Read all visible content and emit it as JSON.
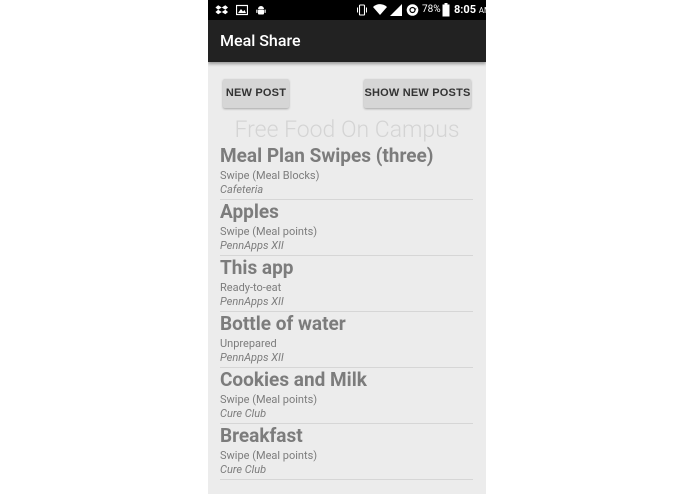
{
  "status_bar": {
    "battery": "78%",
    "time": "8:05",
    "ampm": "AM",
    "icons": [
      "dropbox-icon",
      "image-icon",
      "android-icon",
      "vibrate-icon",
      "wifi-icon",
      "signal-icon",
      "sync-icon",
      "battery-icon"
    ]
  },
  "app_bar": {
    "title": "Meal Share"
  },
  "buttons": {
    "new_post": "NEW POST",
    "show_new_posts": "SHOW NEW POSTS"
  },
  "heading": "Free Food On Campus",
  "posts": [
    {
      "title": "Meal Plan Swipes (three)",
      "type": "Swipe (Meal Blocks)",
      "location": "Cafeteria"
    },
    {
      "title": "Apples",
      "type": "Swipe (Meal points)",
      "location": "PennApps XII"
    },
    {
      "title": "This app",
      "type": "Ready-to-eat",
      "location": "PennApps XII"
    },
    {
      "title": "Bottle of water",
      "type": "Unprepared",
      "location": "PennApps XII"
    },
    {
      "title": "Cookies and Milk",
      "type": "Swipe (Meal points)",
      "location": "Cure Club"
    },
    {
      "title": "Breakfast",
      "type": "Swipe (Meal points)",
      "location": "Cure Club"
    }
  ]
}
